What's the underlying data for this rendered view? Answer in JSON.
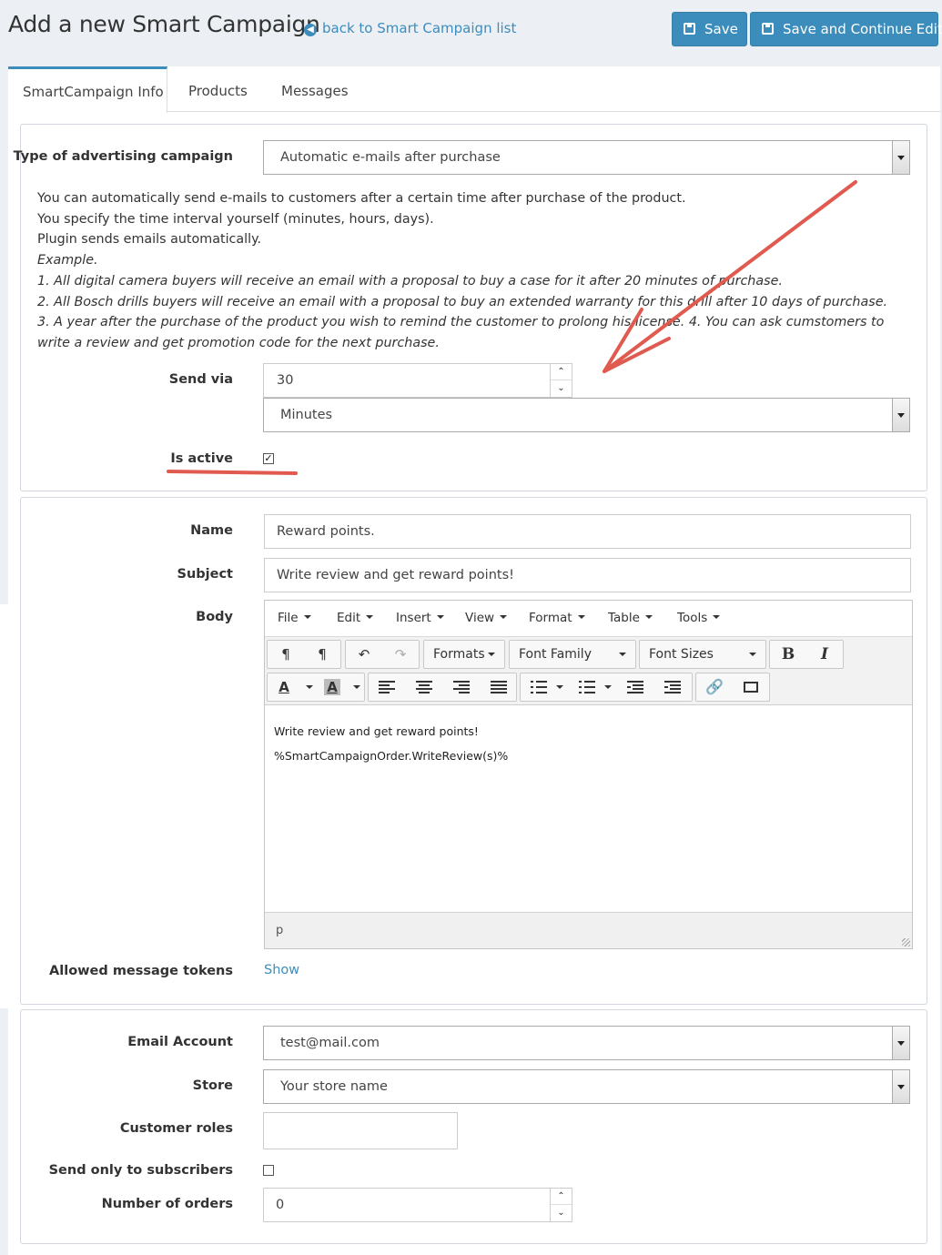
{
  "header": {
    "title": "Add a new Smart Campaign",
    "back_link": "back to Smart Campaign list",
    "save_label": "Save",
    "save_continue_label": "Save and Continue Edit"
  },
  "tabs": [
    {
      "label": "SmartCampaign Info",
      "active": true
    },
    {
      "label": "Products",
      "active": false
    },
    {
      "label": "Messages",
      "active": false
    }
  ],
  "campaign": {
    "type_label": "Type of advertising campaign",
    "type_value": "Automatic e-mails after purchase",
    "description": [
      "You can automatically send e-mails to customers after a certain time after purchase of the product.",
      "You specify the time interval yourself (minutes, hours, days).",
      "Plugin sends emails automatically."
    ],
    "example_label": "Example.",
    "examples": [
      "1. All digital camera buyers will receive an email with a proposal to buy a case for it after 20 minutes of purchase.",
      "2. All Bosch drills buyers will receive an email with a proposal to buy an extended warranty for this drill after 10 days of purchase.",
      "3. A year after the purchase of the product you wish to remind the customer to prolong his license. 4. You can ask cumstomers to write a review and get promotion code for the next purchase."
    ],
    "send_via_label": "Send via",
    "send_via_value": "30",
    "send_via_unit": "Minutes",
    "is_active_label": "Is active",
    "is_active": true
  },
  "message": {
    "name_label": "Name",
    "name_value": "Reward points.",
    "subject_label": "Subject",
    "subject_value": "Write review and get reward points!",
    "body_label": "Body",
    "editor": {
      "menu": [
        "File",
        "Edit",
        "Insert",
        "View",
        "Format",
        "Table",
        "Tools"
      ],
      "formats_label": "Formats",
      "font_family_label": "Font Family",
      "font_sizes_label": "Font Sizes",
      "bold_glyph": "B",
      "italic_glyph": "I",
      "forecolor_glyph": "A",
      "backcolor_glyph": "A",
      "content": [
        "Write review and get reward points!",
        "%SmartCampaignOrder.WriteReview(s)%"
      ],
      "status_path": "p"
    },
    "tokens_label": "Allowed message tokens",
    "tokens_link": "Show"
  },
  "settings": {
    "email_account_label": "Email Account",
    "email_account_value": "test@mail.com",
    "store_label": "Store",
    "store_value": "Your store name",
    "customer_roles_label": "Customer roles",
    "customer_roles_value": "",
    "subscribers_label": "Send only to subscribers",
    "subscribers_checked": false,
    "orders_label": "Number of orders",
    "orders_value": "0"
  },
  "colors": {
    "primary": "#3c8dbc",
    "annotation": "#e05a4f",
    "background": "#ecf0f5"
  }
}
